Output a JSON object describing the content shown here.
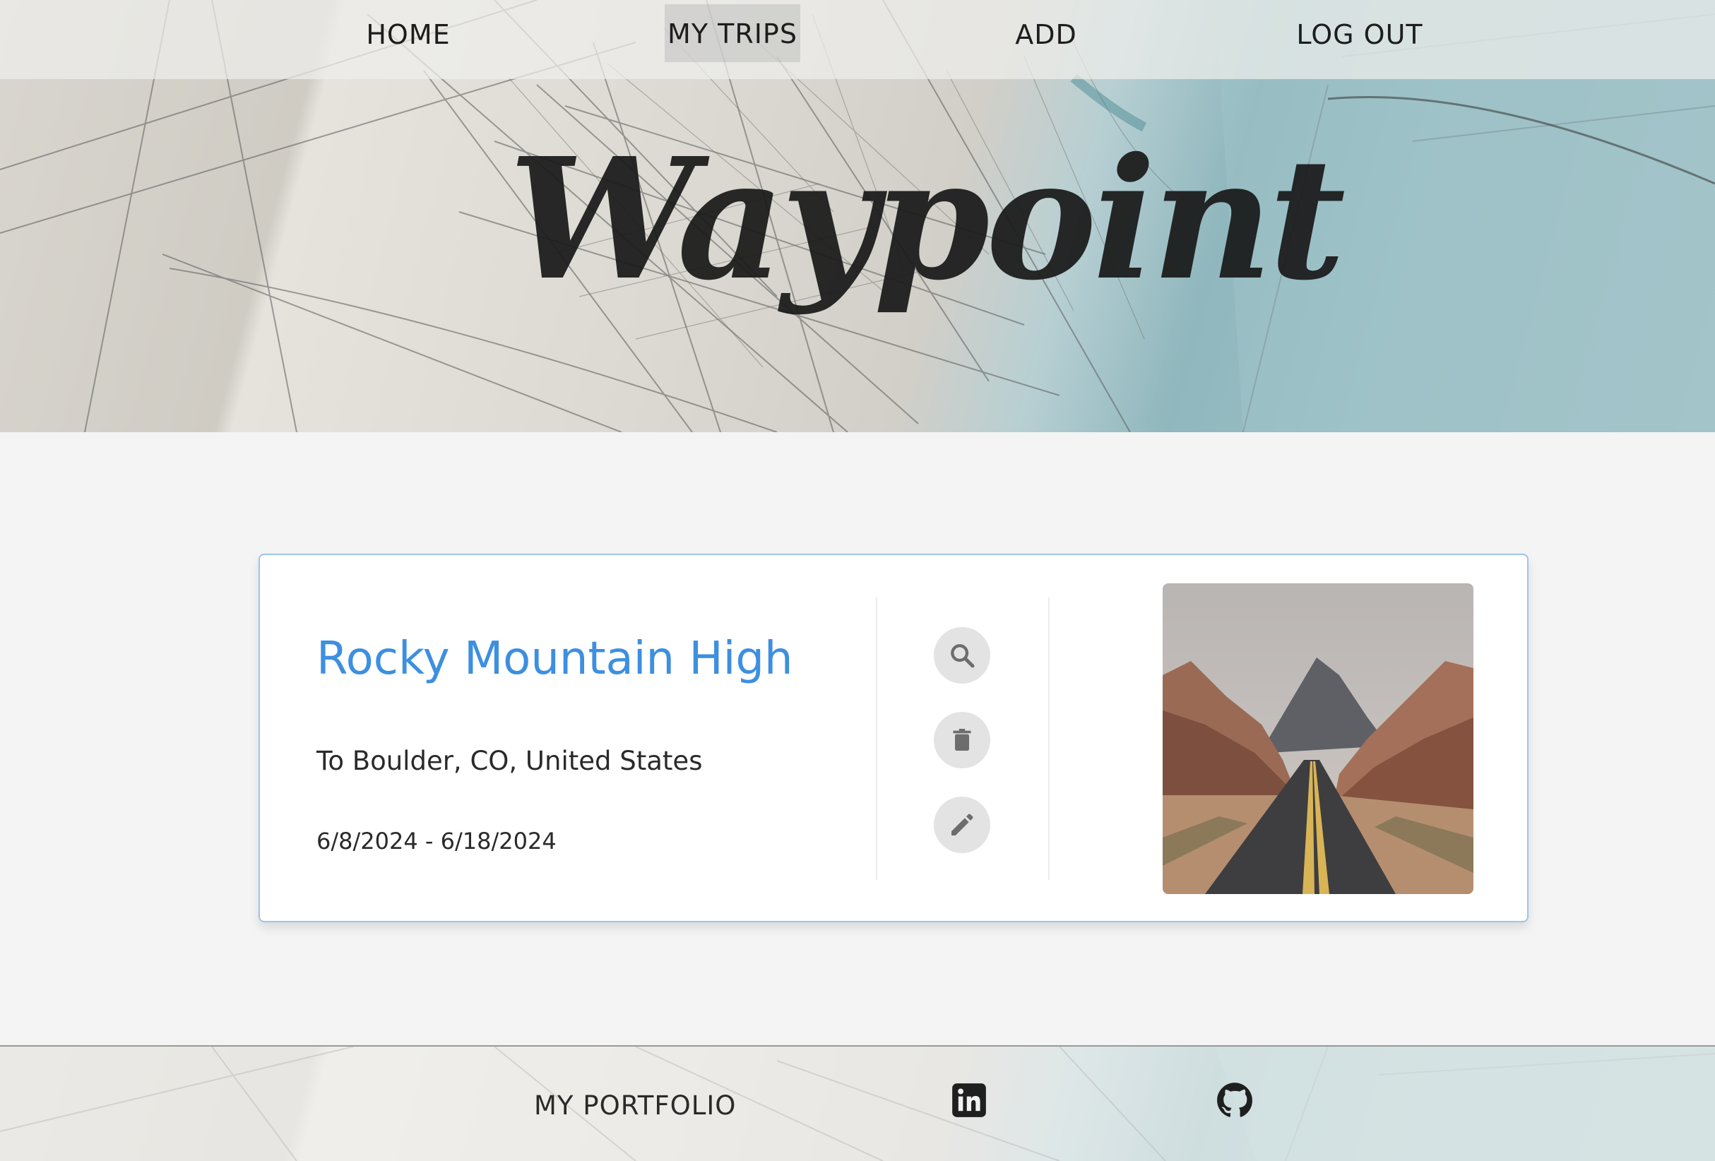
{
  "nav": {
    "items": [
      {
        "label": "HOME"
      },
      {
        "label": "MY TRIPS"
      },
      {
        "label": "ADD"
      },
      {
        "label": "LOG OUT"
      }
    ]
  },
  "header": {
    "logo_text": "Waypoint"
  },
  "trip_card": {
    "title": "Rocky Mountain High",
    "destination": "To Boulder, CO, United States",
    "dates": "6/8/2024 - 6/18/2024",
    "actions": [
      {
        "icon": "search-icon"
      },
      {
        "icon": "trash-icon"
      },
      {
        "icon": "pencil-icon"
      }
    ],
    "photo_icon": "road-canyon-photo"
  },
  "footer": {
    "portfolio_label": "MY PORTFOLIO",
    "social_icons": [
      "linkedin-icon",
      "github-icon"
    ]
  },
  "colors": {
    "accent": "#3d8fe0",
    "card_border": "#9cc5ea",
    "button_bg": "#e3e3e3",
    "page_bg": "#f4f4f4"
  }
}
